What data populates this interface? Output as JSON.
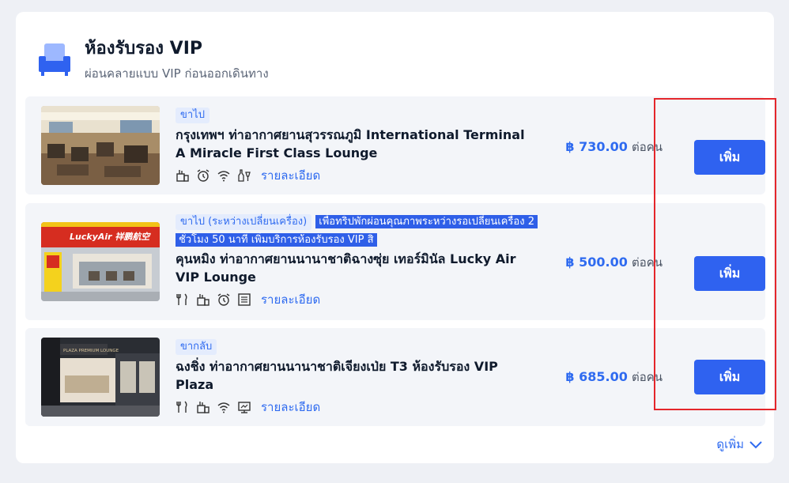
{
  "header": {
    "title": "ห้องรับรอง VIP",
    "subtitle": "ผ่อนคลายแบบ VIP ก่อนออกเดินทาง",
    "icon": "sofa-icon"
  },
  "lounges": [
    {
      "tag": "ขาไป",
      "highlight": "",
      "name_line1": "กรุงเทพฯ ท่าอากาศยานสุวรรณภูมิ International Terminal",
      "name_line2": "A Miracle First Class Lounge",
      "amenities": [
        "food-icon",
        "alarm-clock-icon",
        "wifi-icon",
        "drinks-icon"
      ],
      "details_label": "รายละเอียด",
      "price": "฿ 730.00",
      "per": "ต่อคน",
      "add_label": "เพิ่ม"
    },
    {
      "tag": "ขาไป (ระหว่างเปลี่ยนเครื่อง)",
      "highlight": "เพื่อทริปพักผ่อนคุณภาพระหว่างรอเปลี่ยนเครื่อง 2 ชั่วโมง 50 นาที เพิ่มบริการห้องรับรอง VIP สิ",
      "name_line1": "คุนหมิง ท่าอากาศยานนานาชาติฉางซุ่ย เทอร์มินัล Lucky Air",
      "name_line2": "VIP Lounge",
      "amenities": [
        "utensils-icon",
        "food-icon",
        "alarm-clock-icon",
        "newspaper-icon"
      ],
      "details_label": "รายละเอียด",
      "price": "฿ 500.00",
      "per": "ต่อคน",
      "add_label": "เพิ่ม"
    },
    {
      "tag": "ขากลับ",
      "highlight": "",
      "name_line1": "ฉงชิ่ง ท่าอากาศยานนานาชาติเจียงเป่ย T3 ห้องรับรอง VIP",
      "name_line2": "Plaza",
      "amenities": [
        "utensils-icon",
        "food-icon",
        "wifi-icon",
        "monitor-icon"
      ],
      "details_label": "รายละเอียด",
      "price": "฿ 685.00",
      "per": "ต่อคน",
      "add_label": "เพิ่ม"
    }
  ],
  "photo_text": {
    "lucky_air_sign": "LuckyAir 祥鹏航空",
    "plaza_sign": "PLAZA PREMIUM LOUNGE"
  },
  "more_label": "ดูเพิ่ม",
  "colors": {
    "accent": "#2f62f0",
    "highlight_box": "#e4262b",
    "row_bg": "#f3f5f9"
  }
}
